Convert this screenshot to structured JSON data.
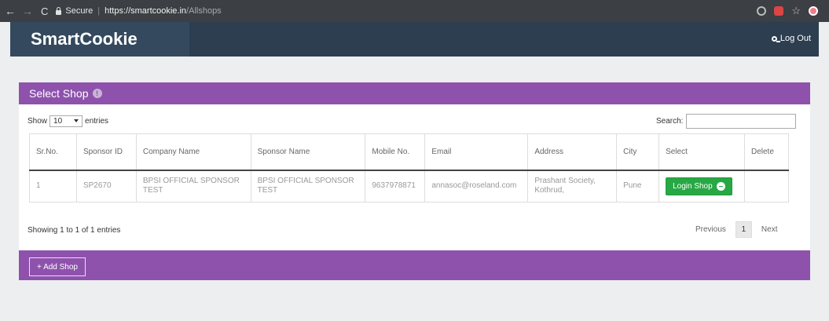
{
  "browser": {
    "secure_label": "Secure",
    "url_base": "https://smartcookie.in",
    "url_path": "/Allshops",
    "back_glyph": "←",
    "forward_glyph": "→",
    "reload_glyph": "C",
    "icons": [
      "camera-icon",
      "extension-icon",
      "star-icon",
      "profile-icon"
    ]
  },
  "header": {
    "brand": "SmartCookie",
    "logout_label": "Log Out",
    "colors": {
      "bar": "#2c3e50",
      "brand_box": "#34495e"
    }
  },
  "panel": {
    "title": "Select Shop",
    "info_glyph": "!",
    "accent": "#8e52ad",
    "length": {
      "show_label": "Show",
      "value": "10",
      "entries_label": "entries"
    },
    "search": {
      "label": "Search:",
      "value": ""
    },
    "columns": [
      "Sr.No.",
      "Sponsor ID",
      "Company Name",
      "Sponsor Name",
      "Mobile No.",
      "Email",
      "Address",
      "City",
      "Select",
      "Delete"
    ],
    "rows": [
      {
        "sr": "1",
        "sponsor_id": "SP2670",
        "company": "BPSI OFFICIAL SPONSOR TEST",
        "sponsor_name": "BPSI OFFICIAL SPONSOR TEST",
        "mobile": "9637978871",
        "email": "annasoc@roseland.com",
        "address": "Prashant Society, Kothrud,",
        "city": "Pune",
        "select_label": "Login Shop",
        "delete": ""
      }
    ],
    "info": "Showing 1 to 1 of 1 entries",
    "pagination": {
      "previous": "Previous",
      "page": "1",
      "next": "Next"
    },
    "footer": {
      "add_label": "+ Add Shop"
    },
    "button_color": "#27a844"
  }
}
